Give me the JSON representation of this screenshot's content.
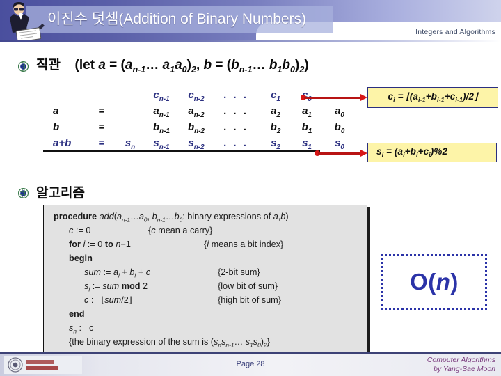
{
  "header": {
    "title": "이진수 덧셈(Addition of Binary Numbers)",
    "section_tag": "Integers and Algorithms",
    "speaker_icon": "presenter-icon"
  },
  "bullets": {
    "intuition": {
      "icon": "globe-bullet-icon",
      "label": "직관",
      "statement": "(let a = (a",
      "full": "직관  (let a = (an-1… a1a0)2, b = (bn-1… b1b0)2)"
    },
    "algorithm": {
      "icon": "globe-bullet-icon",
      "label": "알고리즘"
    }
  },
  "intuition_line": {
    "kor": "직관",
    "open": "(let ",
    "a_var": "a",
    "eq1": " = (",
    "a_hi": "a",
    "a_hi_sub": "n-1",
    "a_ell": "… ",
    "a_1": "a",
    "a_1_sub": "1",
    "a_0": "a",
    "a_0_sub": "0",
    "close1": ")",
    "base1": "2",
    "comma": ", ",
    "b_var": "b",
    "eq2": " = (",
    "b_hi": "b",
    "b_hi_sub": "n-1",
    "b_ell": "… ",
    "b_1": "b",
    "b_1_sub": "1",
    "b_0": "b",
    "b_0_sub": "0",
    "close2": ")",
    "base2": "2",
    "endparen": ")"
  },
  "table": {
    "rows": [
      {
        "name": "carry-row",
        "label": "",
        "eq": "",
        "color": "#2b2f80",
        "cells": [
          "",
          "c|n-1",
          "c|n-2",
          "...",
          "c|1",
          "c|0",
          ""
        ]
      },
      {
        "name": "a-row",
        "label": "a",
        "eq": "=",
        "color": "#111111",
        "cells": [
          "",
          "a|n-1",
          "a|n-2",
          "...",
          "a|2",
          "a|1",
          "a|0"
        ]
      },
      {
        "name": "b-row",
        "label": "b",
        "eq": "=",
        "color": "#111111",
        "cells": [
          "",
          "b|n-1",
          "b|n-2",
          "...",
          "b|2",
          "b|1",
          "b|0"
        ]
      },
      {
        "name": "sum-row",
        "label": "a+b",
        "eq": "=",
        "color": "#2b2f80",
        "cells": [
          "s|n",
          "s|n-1",
          "s|n-2",
          "...",
          "s|2",
          "s|1",
          "s|0"
        ]
      }
    ],
    "ellipsis": ". . ."
  },
  "formula_boxes": [
    {
      "name": "carry-formula",
      "text": "c i = ⌊(a i-1+b i-1+c i-1)/2⌋",
      "plain": "ci = ⌊(ai-1+bi-1+ci-1)/2⌋",
      "bg": "#fdf4a8",
      "border": "#2b2f80"
    },
    {
      "name": "sum-formula",
      "text": "s i = (a i+b i+c i)%2",
      "plain": "si = (ai+bi+ci)%2",
      "bg": "#fdf4a8",
      "border": "#2b2f80"
    }
  ],
  "algorithm": {
    "lines": [
      {
        "code": "procedure add(an-1…a0, bn-1…b0: binary expressions of a,b)",
        "comment": ""
      },
      {
        "code": "c := 0",
        "comment": "{c mean a carry}"
      },
      {
        "code": "for i := 0 to n−1",
        "comment": "{i means a bit index}"
      },
      {
        "code": "begin",
        "comment": ""
      },
      {
        "code": "sum := ai + bi + c",
        "comment": "{2-bit sum}"
      },
      {
        "code": "si := sum mod 2",
        "comment": "{low bit of sum}"
      },
      {
        "code": "c := ⌊sum/2⌋",
        "comment": "{high bit of sum}"
      },
      {
        "code": "end",
        "comment": ""
      },
      {
        "code": "sn := c",
        "comment": ""
      },
      {
        "code": "{the binary expression of the sum is (snsn-1… s1s0)2}",
        "comment": ""
      }
    ]
  },
  "complexity": {
    "label": "O(n)",
    "o": "O(",
    "n": "n",
    "close": ")",
    "color": "#2b33a8"
  },
  "footer": {
    "page": "Page 28",
    "course": "Computer Algorithms",
    "author": "by Yang-Sae Moon",
    "logo": "university-seal-logo",
    "color": "#7a3b7e"
  }
}
